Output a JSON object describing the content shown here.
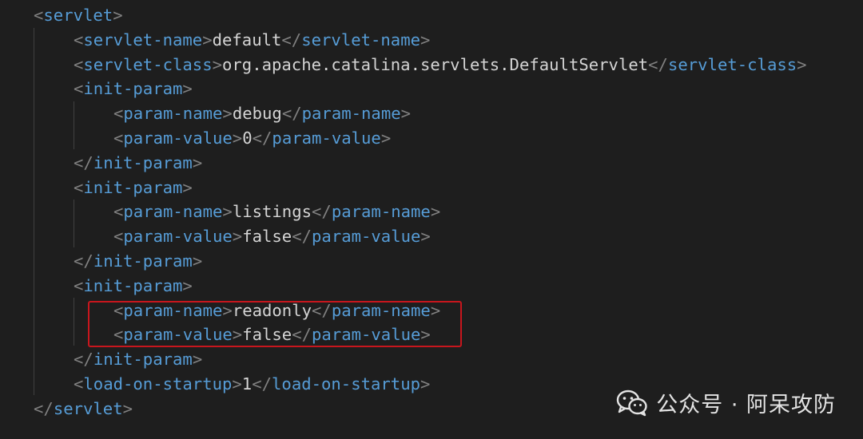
{
  "code": {
    "language": "xml",
    "lines": [
      {
        "indent": 0,
        "open": "servlet",
        "text": "",
        "close": ""
      },
      {
        "indent": 1,
        "open": "servlet-name",
        "text": "default",
        "close": "servlet-name"
      },
      {
        "indent": 1,
        "open": "servlet-class",
        "text": "org.apache.catalina.servlets.DefaultServlet",
        "close": "servlet-class"
      },
      {
        "indent": 1,
        "open": "init-param",
        "text": "",
        "close": ""
      },
      {
        "indent": 2,
        "open": "param-name",
        "text": "debug",
        "close": "param-name"
      },
      {
        "indent": 2,
        "open": "param-value",
        "text": "0",
        "close": "param-value"
      },
      {
        "indent": 1,
        "open": "",
        "text": "",
        "close": "init-param"
      },
      {
        "indent": 1,
        "open": "init-param",
        "text": "",
        "close": ""
      },
      {
        "indent": 2,
        "open": "param-name",
        "text": "listings",
        "close": "param-name"
      },
      {
        "indent": 2,
        "open": "param-value",
        "text": "false",
        "close": "param-value"
      },
      {
        "indent": 1,
        "open": "",
        "text": "",
        "close": "init-param"
      },
      {
        "indent": 1,
        "open": "init-param",
        "text": "",
        "close": ""
      },
      {
        "indent": 2,
        "open": "param-name",
        "text": "readonly",
        "close": "param-name"
      },
      {
        "indent": 2,
        "open": "param-value",
        "text": "false",
        "close": "param-value"
      },
      {
        "indent": 1,
        "open": "",
        "text": "",
        "close": "init-param"
      },
      {
        "indent": 1,
        "open": "load-on-startup",
        "text": "1",
        "close": "load-on-startup"
      },
      {
        "indent": 0,
        "open": "",
        "text": "",
        "close": "servlet"
      }
    ]
  },
  "highlight": {
    "color": "#c8161d"
  },
  "watermark": {
    "icon": "wechat-icon",
    "text": "公众号 · 阿呆攻防"
  },
  "colors": {
    "background": "#1e1e1e",
    "tag": "#569cd6",
    "bracket": "#808080",
    "text": "#d4d4d4"
  }
}
